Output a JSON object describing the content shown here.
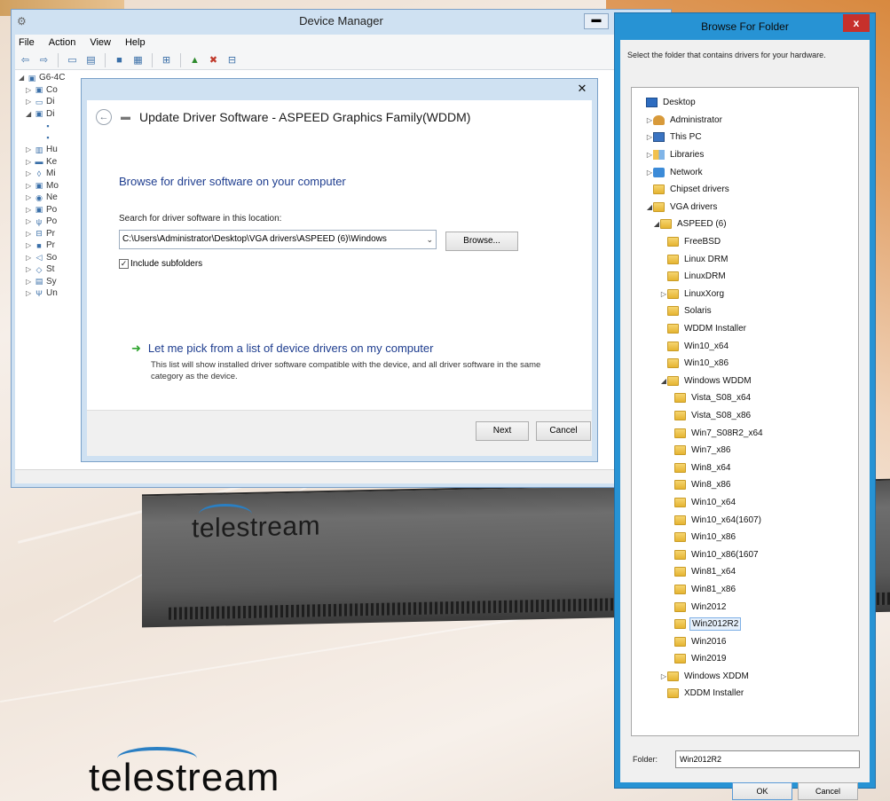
{
  "device_manager": {
    "title": "Device Manager",
    "menu": [
      "File",
      "Action",
      "View",
      "Help"
    ],
    "tree_root": "G6-4C",
    "tree_rows": [
      "Co",
      "Di",
      "Di",
      "",
      "",
      "Hu",
      "Ke",
      "Mi",
      "Mo",
      "Ne",
      "Po",
      "Po",
      "Pr",
      "Pr",
      "So",
      "St",
      "Sy",
      "Un"
    ]
  },
  "update_driver": {
    "title": "Update Driver Software - ASPEED Graphics Family(WDDM)",
    "heading": "Browse for driver software on your computer",
    "search_label": "Search for driver software in this location:",
    "path_value": "C:\\Users\\Administrator\\Desktop\\VGA drivers\\ASPEED (6)\\Windows",
    "browse_label": "Browse...",
    "include_subfolders_label": "Include subfolders",
    "include_subfolders_checked": true,
    "pick_title": "Let me pick from a list of device drivers on my computer",
    "pick_desc": "This list will show installed driver software compatible with the device, and all driver software in the same category as the device.",
    "next_label": "Next",
    "cancel_label": "Cancel"
  },
  "browse_folder": {
    "title": "Browse For Folder",
    "close_label": "x",
    "description": "Select the folder that contains drivers for your hardware.",
    "tree": [
      {
        "label": "Desktop",
        "depth": 0,
        "expander": "",
        "icon": "desktop-icon"
      },
      {
        "label": "Administrator",
        "depth": 1,
        "expander": "▷",
        "icon": "user-icon"
      },
      {
        "label": "This PC",
        "depth": 1,
        "expander": "▷",
        "icon": "pc-icon"
      },
      {
        "label": "Libraries",
        "depth": 1,
        "expander": "▷",
        "icon": "library-icon"
      },
      {
        "label": "Network",
        "depth": 1,
        "expander": "▷",
        "icon": "network-icon"
      },
      {
        "label": "Chipset drivers",
        "depth": 1,
        "expander": "",
        "icon": "folder-icon"
      },
      {
        "label": "VGA drivers",
        "depth": 1,
        "expander": "◢",
        "icon": "folder-icon"
      },
      {
        "label": "ASPEED (6)",
        "depth": 2,
        "expander": "◢",
        "icon": "folder-icon"
      },
      {
        "label": "FreeBSD",
        "depth": 3,
        "expander": "",
        "icon": "folder-icon"
      },
      {
        "label": "Linux DRM",
        "depth": 3,
        "expander": "",
        "icon": "folder-icon"
      },
      {
        "label": "LinuxDRM",
        "depth": 3,
        "expander": "",
        "icon": "folder-icon"
      },
      {
        "label": "LinuxXorg",
        "depth": 3,
        "expander": "▷",
        "icon": "folder-icon"
      },
      {
        "label": "Solaris",
        "depth": 3,
        "expander": "",
        "icon": "folder-icon"
      },
      {
        "label": "WDDM Installer",
        "depth": 3,
        "expander": "",
        "icon": "folder-icon"
      },
      {
        "label": "Win10_x64",
        "depth": 3,
        "expander": "",
        "icon": "folder-icon"
      },
      {
        "label": "Win10_x86",
        "depth": 3,
        "expander": "",
        "icon": "folder-icon"
      },
      {
        "label": "Windows WDDM",
        "depth": 3,
        "expander": "◢",
        "icon": "folder-icon"
      },
      {
        "label": "Vista_S08_x64",
        "depth": 4,
        "expander": "",
        "icon": "folder-icon"
      },
      {
        "label": "Vista_S08_x86",
        "depth": 4,
        "expander": "",
        "icon": "folder-icon"
      },
      {
        "label": "Win7_S08R2_x64",
        "depth": 4,
        "expander": "",
        "icon": "folder-icon"
      },
      {
        "label": "Win7_x86",
        "depth": 4,
        "expander": "",
        "icon": "folder-icon"
      },
      {
        "label": "Win8_x64",
        "depth": 4,
        "expander": "",
        "icon": "folder-icon"
      },
      {
        "label": "Win8_x86",
        "depth": 4,
        "expander": "",
        "icon": "folder-icon"
      },
      {
        "label": "Win10_x64",
        "depth": 4,
        "expander": "",
        "icon": "folder-icon"
      },
      {
        "label": "Win10_x64(1607)",
        "depth": 4,
        "expander": "",
        "icon": "folder-icon"
      },
      {
        "label": "Win10_x86",
        "depth": 4,
        "expander": "",
        "icon": "folder-icon"
      },
      {
        "label": "Win10_x86(1607",
        "depth": 4,
        "expander": "",
        "icon": "folder-icon"
      },
      {
        "label": "Win81_x64",
        "depth": 4,
        "expander": "",
        "icon": "folder-icon"
      },
      {
        "label": "Win81_x86",
        "depth": 4,
        "expander": "",
        "icon": "folder-icon"
      },
      {
        "label": "Win2012",
        "depth": 4,
        "expander": "",
        "icon": "folder-icon"
      },
      {
        "label": "Win2012R2",
        "depth": 4,
        "expander": "",
        "icon": "folder-icon",
        "selected": true
      },
      {
        "label": "Win2016",
        "depth": 4,
        "expander": "",
        "icon": "folder-icon"
      },
      {
        "label": "Win2019",
        "depth": 4,
        "expander": "",
        "icon": "folder-icon"
      },
      {
        "label": "Windows XDDM",
        "depth": 3,
        "expander": "▷",
        "icon": "folder-icon"
      },
      {
        "label": "XDDM Installer",
        "depth": 3,
        "expander": "",
        "icon": "folder-icon"
      }
    ],
    "folder_label": "Folder:",
    "folder_value": "Win2012R2",
    "ok_label": "OK",
    "cancel_label": "Cancel"
  },
  "background": {
    "brand_text": "telestream",
    "device_text": "telestream"
  },
  "colors": {
    "window_chrome": "#cfe1f2",
    "active_chrome": "#2793d4",
    "close_red": "#c7302b",
    "link_blue": "#1e3d8f",
    "arrow_green": "#2ea42e",
    "brand_blue": "#2a7fc3"
  }
}
